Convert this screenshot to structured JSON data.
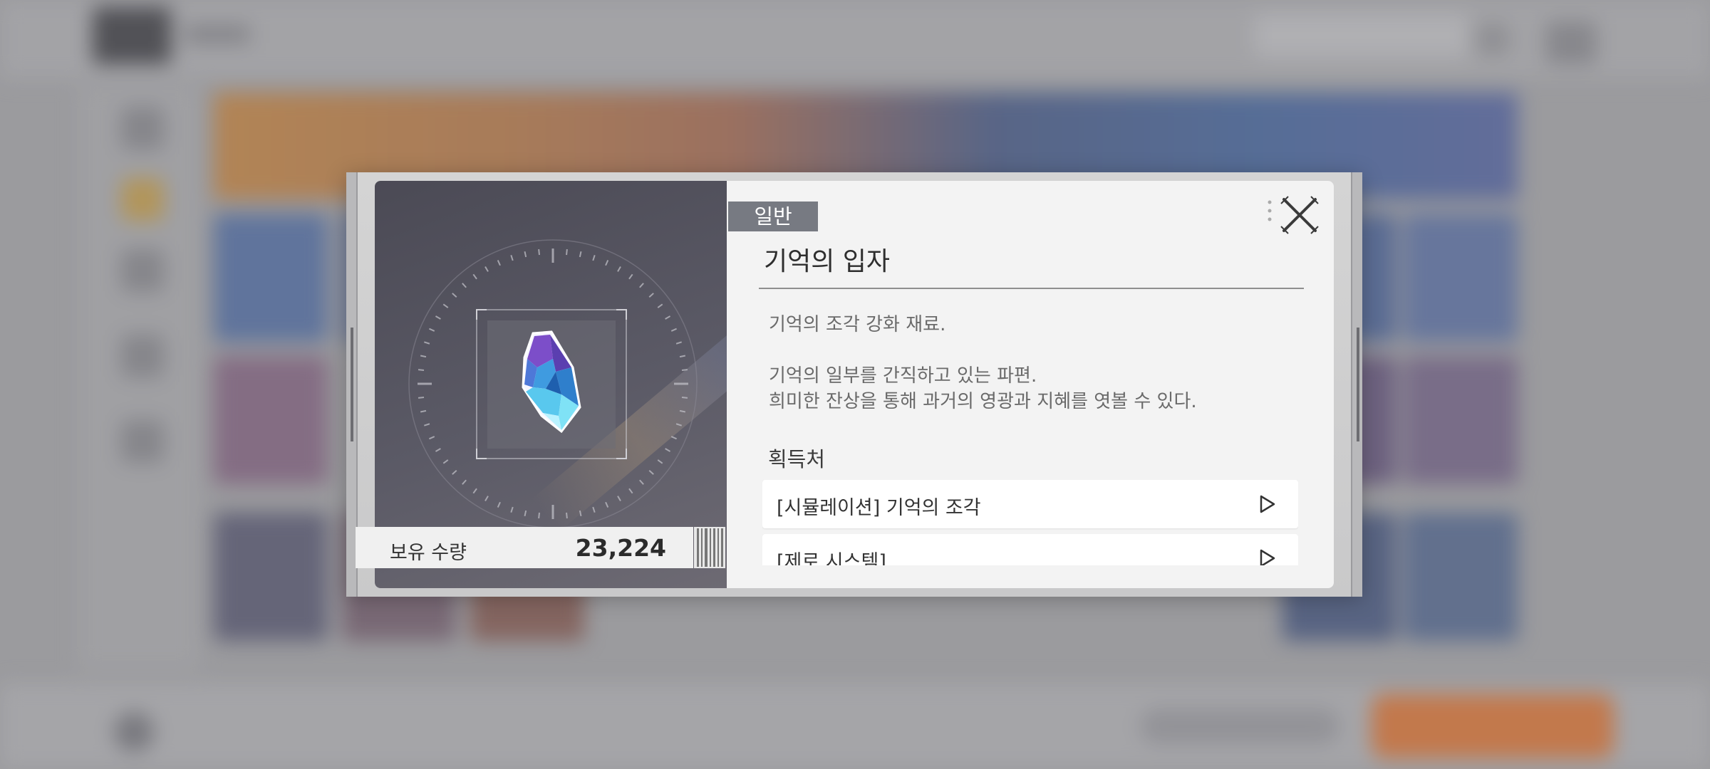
{
  "modal": {
    "category": "일반",
    "item_name": "기억의 입자",
    "description_lines": [
      "기억의 조각 강화 재료.",
      "기억의 일부를 간직하고 있는 파편.",
      "희미한 잔상을 통해 과거의 영광과 지혜를 엿볼 수 있다."
    ],
    "sources_title": "획득처",
    "sources": [
      {
        "label": "[시뮬레이션] 기억의 조각"
      },
      {
        "label": "[제로 시스템]"
      }
    ],
    "owned_label": "보유 수량",
    "owned_value": "23,224"
  },
  "icons": {
    "close": "close-icon",
    "play": "play-icon",
    "item": "crystal-shard-icon"
  },
  "colors": {
    "tag_bg": "#777a82",
    "panel_bg": "#4b4a55",
    "modal_bg": "#f3f3f3"
  }
}
